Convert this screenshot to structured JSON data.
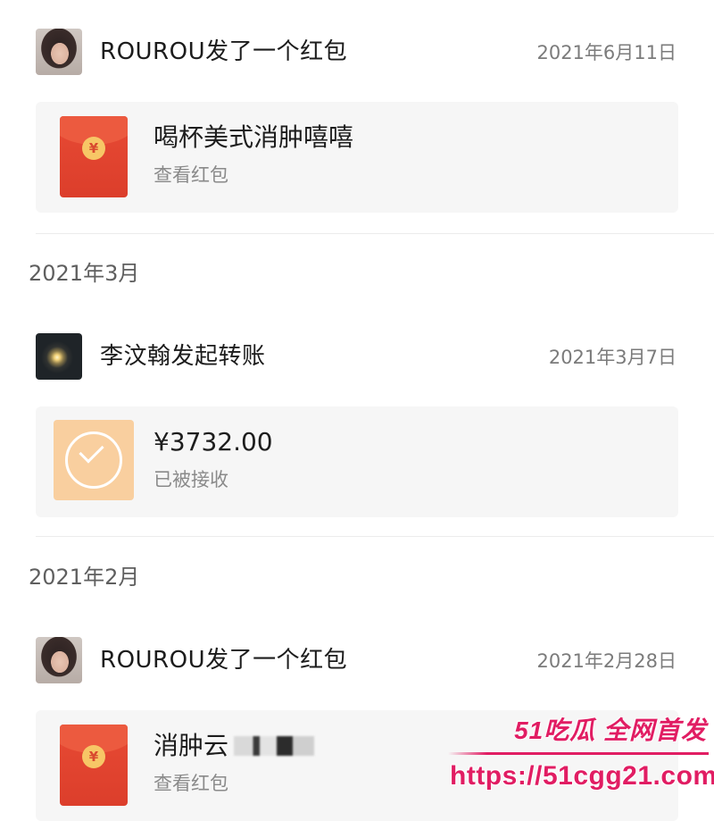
{
  "entries": [
    {
      "sender": "ROUROU发了一个红包",
      "date": "2021年6月11日",
      "card_title": "喝杯美式消肿嘻嘻",
      "card_subtitle": "查看红包",
      "type": "red-packet"
    },
    {
      "sender": "李汶翰发起转账",
      "date": "2021年3月7日",
      "card_title": "¥3732.00",
      "card_subtitle": "已被接收",
      "type": "transfer"
    },
    {
      "sender": "ROUROU发了一个红包",
      "date": "2021年2月28日",
      "card_title": "消肿云",
      "card_subtitle": "查看红包",
      "type": "red-packet"
    }
  ],
  "months": [
    "2021年3月",
    "2021年2月"
  ],
  "icons": {
    "red_packet_coin": "¥"
  },
  "watermark": {
    "logo": "51吃瓜 全网首发",
    "url": "https://51cgg21.com"
  },
  "colors": {
    "red_packet": "#e74a34",
    "transfer": "#f9cf9f",
    "card_bg": "#f6f6f6",
    "watermark": "#e11d63"
  }
}
